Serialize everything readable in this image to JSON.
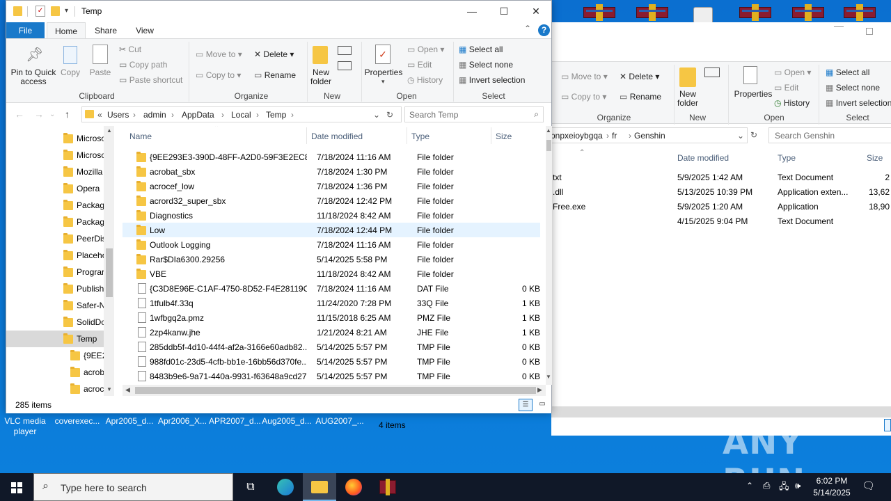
{
  "desktop": {
    "labels": [
      "VLC media player",
      "coverexec...",
      "Apr2005_d...",
      "Apr2006_X...",
      "APR2007_d...",
      "Aug2005_d...",
      "AUG2007_..."
    ],
    "watermark": "ANY RUN"
  },
  "back_window": {
    "ribbon": {
      "move_to": "Move to",
      "copy_to": "Copy to",
      "delete": "Delete",
      "rename": "Rename",
      "new_folder": "New folder",
      "properties": "Properties",
      "open": "Open",
      "edit": "Edit",
      "history": "History",
      "select_all": "Select all",
      "select_none": "Select none",
      "invert_selection": "Invert selection",
      "group_organize": "Organize",
      "group_new": "New",
      "group_open": "Open",
      "group_select": "Select"
    },
    "address": {
      "parts": [
        "‎pnpxeioybgqa",
        "fr",
        "Genshin"
      ],
      "search_placeholder": "Search Genshin"
    },
    "columns": {
      "date": "Date modified",
      "type": "Type",
      "size": "Size"
    },
    "rows": [
      {
        "name": "txt",
        "date": "5/9/2025 1:42 AM",
        "type": "Text Document",
        "size": "2"
      },
      {
        "name": ".dll",
        "date": "5/13/2025 10:39 PM",
        "type": "Application exten...",
        "size": "13,62"
      },
      {
        "name": "Free.exe",
        "date": "5/9/2025 1:20 AM",
        "type": "Application",
        "size": "18,90"
      },
      {
        "name": "",
        "date": "4/15/2025 9:04 PM",
        "type": "Text Document",
        "size": ""
      }
    ],
    "status": "4 items"
  },
  "window": {
    "title": "Temp",
    "tabs": {
      "file": "File",
      "home": "Home",
      "share": "Share",
      "view": "View"
    },
    "ribbon": {
      "pin": "Pin to Quick access",
      "copy": "Copy",
      "paste": "Paste",
      "cut": "Cut",
      "copy_path": "Copy path",
      "paste_shortcut": "Paste shortcut",
      "move_to": "Move to",
      "copy_to": "Copy to",
      "delete": "Delete",
      "rename": "Rename",
      "new_folder": "New folder",
      "properties": "Properties",
      "open": "Open",
      "edit": "Edit",
      "history": "History",
      "select_all": "Select all",
      "select_none": "Select none",
      "invert_selection": "Invert selection",
      "group_clipboard": "Clipboard",
      "group_organize": "Organize",
      "group_new": "New",
      "group_open": "Open",
      "group_select": "Select"
    },
    "address": {
      "overflow": "«",
      "parts": [
        "Users",
        "admin",
        "AppData",
        "Local",
        "Temp"
      ],
      "search_placeholder": "Search Temp"
    },
    "nav_items": [
      {
        "label": "Microso",
        "indent": 0
      },
      {
        "label": "Microso",
        "indent": 0
      },
      {
        "label": "Mozilla",
        "indent": 0
      },
      {
        "label": "Opera",
        "indent": 0
      },
      {
        "label": "Packag",
        "indent": 0
      },
      {
        "label": "Packag",
        "indent": 0
      },
      {
        "label": "PeerDis",
        "indent": 0
      },
      {
        "label": "Placeho",
        "indent": 0
      },
      {
        "label": "Prograr",
        "indent": 0
      },
      {
        "label": "Publish",
        "indent": 0
      },
      {
        "label": "Safer-N",
        "indent": 0
      },
      {
        "label": "SolidDo",
        "indent": 0
      },
      {
        "label": "Temp",
        "indent": 0,
        "selected": true
      },
      {
        "label": "{9EE29",
        "indent": 1
      },
      {
        "label": "acrob",
        "indent": 1
      },
      {
        "label": "acroc",
        "indent": 1
      }
    ],
    "columns": {
      "name": "Name",
      "date": "Date modified",
      "type": "Type",
      "size": "Size"
    },
    "rows": [
      {
        "name": "{9EE293E3-390D-48FF-A2D0-59F3E2EC88...",
        "date": "7/18/2024 11:16 AM",
        "type": "File folder",
        "size": "",
        "kind": "folder"
      },
      {
        "name": "acrobat_sbx",
        "date": "7/18/2024 1:30 PM",
        "type": "File folder",
        "size": "",
        "kind": "folder"
      },
      {
        "name": "acrocef_low",
        "date": "7/18/2024 1:36 PM",
        "type": "File folder",
        "size": "",
        "kind": "folder"
      },
      {
        "name": "acrord32_super_sbx",
        "date": "7/18/2024 12:42 PM",
        "type": "File folder",
        "size": "",
        "kind": "folder"
      },
      {
        "name": "Diagnostics",
        "date": "11/18/2024 8:42 AM",
        "type": "File folder",
        "size": "",
        "kind": "folder"
      },
      {
        "name": "Low",
        "date": "7/18/2024 12:44 PM",
        "type": "File folder",
        "size": "",
        "kind": "folder",
        "hover": true
      },
      {
        "name": "Outlook Logging",
        "date": "7/18/2024 11:16 AM",
        "type": "File folder",
        "size": "",
        "kind": "folder"
      },
      {
        "name": "Rar$DIa6300.29256",
        "date": "5/14/2025 5:58 PM",
        "type": "File folder",
        "size": "",
        "kind": "folder"
      },
      {
        "name": "VBE",
        "date": "11/18/2024 8:42 AM",
        "type": "File folder",
        "size": "",
        "kind": "folder"
      },
      {
        "name": "{C3D8E96E-C1AF-4750-8D52-F4E28119C1...",
        "date": "7/18/2024 11:16 AM",
        "type": "DAT File",
        "size": "0 KB",
        "kind": "file"
      },
      {
        "name": "1tfulb4f.33q",
        "date": "11/24/2020 7:28 PM",
        "type": "33Q File",
        "size": "1 KB",
        "kind": "file"
      },
      {
        "name": "1wfbgq2a.pmz",
        "date": "11/15/2018 6:25 AM",
        "type": "PMZ File",
        "size": "1 KB",
        "kind": "file"
      },
      {
        "name": "2zp4kanw.jhe",
        "date": "1/21/2024 8:21 AM",
        "type": "JHE File",
        "size": "1 KB",
        "kind": "file"
      },
      {
        "name": "285ddb5f-4d10-44f4-af2a-3166e60adb82....",
        "date": "5/14/2025 5:57 PM",
        "type": "TMP File",
        "size": "0 KB",
        "kind": "file"
      },
      {
        "name": "988fd01c-23d5-4cfb-bb1e-16bb56d370fe....",
        "date": "5/14/2025 5:57 PM",
        "type": "TMP File",
        "size": "0 KB",
        "kind": "file"
      },
      {
        "name": "8483b9e6-9a71-440a-9931-f63648a9cd27....",
        "date": "5/14/2025 5:57 PM",
        "type": "TMP File",
        "size": "0 KB",
        "kind": "file"
      }
    ],
    "status": "285 items"
  },
  "taskbar": {
    "search_placeholder": "Type here to search",
    "time": "6:02 PM",
    "date": "5/14/2025"
  }
}
